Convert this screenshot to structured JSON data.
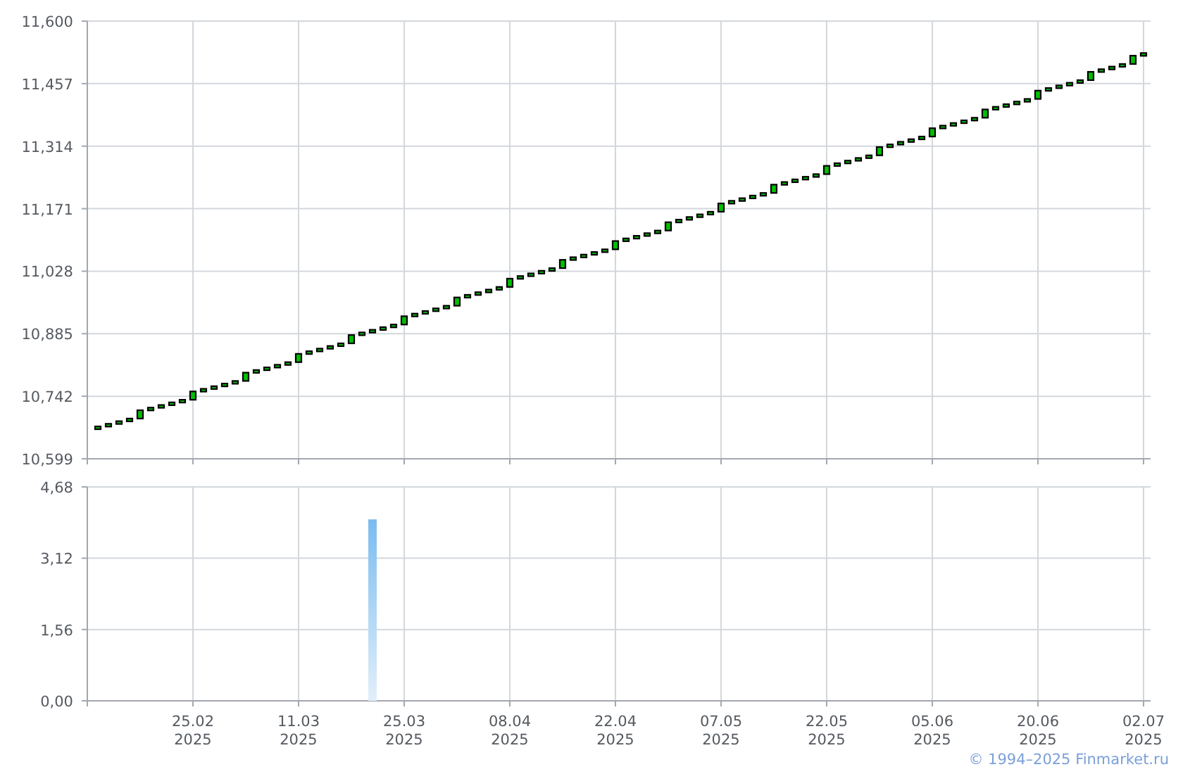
{
  "price_chart": {
    "chart_data": {
      "type": "candlestick",
      "grid": true,
      "categories": [
        null,
        null,
        null,
        null,
        null,
        null,
        null,
        null,
        null,
        null,
        null,
        null,
        null,
        null,
        null,
        null,
        null,
        null,
        null,
        null,
        null,
        null,
        null,
        null,
        null,
        null,
        null,
        null,
        null,
        null,
        null,
        null,
        null,
        null,
        null,
        null,
        null,
        null,
        null,
        null,
        null,
        null,
        null,
        null,
        null,
        null,
        null,
        null,
        null,
        null,
        null,
        null,
        null,
        null,
        null,
        null,
        null,
        null,
        null,
        null,
        null,
        null,
        null,
        null,
        null,
        null,
        null,
        null,
        null,
        null,
        null,
        null,
        null,
        null,
        null,
        null,
        null,
        null,
        null,
        null,
        null,
        null,
        null,
        null,
        null,
        null,
        null,
        null,
        null,
        null,
        null,
        null,
        null,
        null,
        null,
        null,
        null,
        null,
        null,
        null
      ],
      "ohlc": [
        [
          10667,
          10673,
          10667,
          10673
        ],
        [
          10673,
          10679,
          10673,
          10679
        ],
        [
          10679,
          10685,
          10679,
          10685
        ],
        [
          10685,
          10691,
          10685,
          10691
        ],
        [
          10691,
          10710,
          10691,
          10710
        ],
        [
          10710,
          10716,
          10710,
          10716
        ],
        [
          10716,
          10722,
          10716,
          10722
        ],
        [
          10722,
          10728,
          10722,
          10728
        ],
        [
          10728,
          10734,
          10728,
          10734
        ],
        [
          10734,
          10753,
          10734,
          10753
        ],
        [
          10753,
          10759,
          10753,
          10759
        ],
        [
          10759,
          10765,
          10759,
          10765
        ],
        [
          10765,
          10771,
          10765,
          10771
        ],
        [
          10771,
          10777,
          10771,
          10777
        ],
        [
          10777,
          10796,
          10777,
          10796
        ],
        [
          10796,
          10802,
          10796,
          10802
        ],
        [
          10802,
          10808,
          10802,
          10808
        ],
        [
          10808,
          10814,
          10808,
          10814
        ],
        [
          10814,
          10820,
          10814,
          10820
        ],
        [
          10820,
          10839,
          10820,
          10839
        ],
        [
          10839,
          10845,
          10839,
          10845
        ],
        [
          10845,
          10851,
          10845,
          10851
        ],
        [
          10851,
          10857,
          10851,
          10857
        ],
        [
          10857,
          10863,
          10857,
          10863
        ],
        [
          10863,
          10882,
          10863,
          10882
        ],
        [
          10882,
          10888,
          10882,
          10888
        ],
        [
          10888,
          10894,
          10888,
          10894
        ],
        [
          10894,
          10900,
          10894,
          10900
        ],
        [
          10900,
          10906,
          10900,
          10906
        ],
        [
          10906,
          10925,
          10906,
          10925
        ],
        [
          10925,
          10931,
          10925,
          10931
        ],
        [
          10931,
          10937,
          10931,
          10937
        ],
        [
          10937,
          10943,
          10937,
          10943
        ],
        [
          10943,
          10949,
          10943,
          10949
        ],
        [
          10949,
          10968,
          10949,
          10968
        ],
        [
          10968,
          10974,
          10968,
          10974
        ],
        [
          10974,
          10980,
          10974,
          10980
        ],
        [
          10980,
          10986,
          10980,
          10986
        ],
        [
          10986,
          10992,
          10986,
          10992
        ],
        [
          10992,
          11011,
          10992,
          11011
        ],
        [
          11011,
          11017,
          11011,
          11017
        ],
        [
          11017,
          11023,
          11017,
          11023
        ],
        [
          11023,
          11029,
          11023,
          11029
        ],
        [
          11029,
          11035,
          11029,
          11035
        ],
        [
          11035,
          11054,
          11035,
          11054
        ],
        [
          11054,
          11060,
          11054,
          11060
        ],
        [
          11060,
          11066,
          11060,
          11066
        ],
        [
          11066,
          11072,
          11066,
          11072
        ],
        [
          11072,
          11078,
          11072,
          11078
        ],
        [
          11078,
          11097,
          11078,
          11097
        ],
        [
          11097,
          11103,
          11097,
          11103
        ],
        [
          11103,
          11109,
          11103,
          11109
        ],
        [
          11109,
          11115,
          11109,
          11115
        ],
        [
          11115,
          11121,
          11115,
          11121
        ],
        [
          11121,
          11140,
          11121,
          11140
        ],
        [
          11140,
          11146,
          11140,
          11146
        ],
        [
          11146,
          11152,
          11146,
          11152
        ],
        [
          11152,
          11158,
          11152,
          11158
        ],
        [
          11158,
          11164,
          11158,
          11164
        ],
        [
          11164,
          11183,
          11164,
          11183
        ],
        [
          11183,
          11189,
          11183,
          11189
        ],
        [
          11189,
          11195,
          11189,
          11195
        ],
        [
          11195,
          11201,
          11195,
          11201
        ],
        [
          11201,
          11207,
          11201,
          11207
        ],
        [
          11207,
          11226,
          11207,
          11226
        ],
        [
          11226,
          11232,
          11226,
          11232
        ],
        [
          11232,
          11238,
          11232,
          11238
        ],
        [
          11238,
          11244,
          11238,
          11244
        ],
        [
          11244,
          11250,
          11244,
          11250
        ],
        [
          11250,
          11269,
          11250,
          11269
        ],
        [
          11269,
          11275,
          11269,
          11275
        ],
        [
          11275,
          11281,
          11275,
          11281
        ],
        [
          11281,
          11287,
          11281,
          11287
        ],
        [
          11287,
          11293,
          11287,
          11293
        ],
        [
          11293,
          11312,
          11293,
          11312
        ],
        [
          11312,
          11318,
          11312,
          11318
        ],
        [
          11318,
          11324,
          11318,
          11324
        ],
        [
          11324,
          11330,
          11324,
          11330
        ],
        [
          11330,
          11336,
          11330,
          11336
        ],
        [
          11336,
          11355,
          11336,
          11355
        ],
        [
          11355,
          11361,
          11355,
          11361
        ],
        [
          11361,
          11367,
          11361,
          11367
        ],
        [
          11367,
          11373,
          11367,
          11373
        ],
        [
          11373,
          11379,
          11373,
          11379
        ],
        [
          11379,
          11398,
          11379,
          11398
        ],
        [
          11398,
          11404,
          11398,
          11404
        ],
        [
          11404,
          11410,
          11404,
          11410
        ],
        [
          11410,
          11416,
          11410,
          11416
        ],
        [
          11416,
          11422,
          11416,
          11422
        ],
        [
          11422,
          11441,
          11422,
          11441
        ],
        [
          11441,
          11447,
          11441,
          11447
        ],
        [
          11447,
          11453,
          11447,
          11453
        ],
        [
          11453,
          11459,
          11453,
          11459
        ],
        [
          11459,
          11465,
          11459,
          11465
        ],
        [
          11465,
          11484,
          11465,
          11484
        ],
        [
          11484,
          11490,
          11484,
          11490
        ],
        [
          11490,
          11496,
          11490,
          11496
        ],
        [
          11496,
          11502,
          11496,
          11502
        ],
        [
          11502,
          11521,
          11502,
          11521
        ],
        [
          11521,
          11527,
          11521,
          11527
        ]
      ],
      "ylim": [
        10599,
        11600
      ],
      "yticks": [
        {
          "value": 10599,
          "label": "10,599"
        },
        {
          "value": 10742,
          "label": "10,742"
        },
        {
          "value": 10885,
          "label": "10,885"
        },
        {
          "value": 11028,
          "label": "11,028"
        },
        {
          "value": 11171,
          "label": "11,171"
        },
        {
          "value": 11314,
          "label": "11,314"
        },
        {
          "value": 11457,
          "label": "11,457"
        },
        {
          "value": 11600,
          "label": "11,600"
        }
      ]
    }
  },
  "volume_chart": {
    "chart_data": {
      "type": "bar",
      "grid": true,
      "categories": [
        null,
        null,
        null,
        null,
        null,
        null,
        null,
        null,
        null,
        "25.02\n2025",
        null,
        null,
        null,
        null,
        null,
        null,
        null,
        null,
        null,
        "11.03\n2025",
        null,
        null,
        null,
        null,
        null,
        null,
        null,
        null,
        null,
        "25.03\n2025",
        null,
        null,
        null,
        null,
        null,
        null,
        null,
        null,
        null,
        "08.04\n2025",
        null,
        null,
        null,
        null,
        null,
        null,
        null,
        null,
        null,
        "22.04\n2025",
        null,
        null,
        null,
        null,
        null,
        null,
        null,
        null,
        null,
        "07.05\n2025",
        null,
        null,
        null,
        null,
        null,
        null,
        null,
        null,
        null,
        "22.05\n2025",
        null,
        null,
        null,
        null,
        null,
        null,
        null,
        null,
        null,
        "05.06\n2025",
        null,
        null,
        null,
        null,
        null,
        null,
        null,
        null,
        null,
        "20.06\n2025",
        null,
        null,
        null,
        null,
        null,
        null,
        null,
        null,
        null,
        "02.07\n2025"
      ],
      "values": [
        null,
        null,
        null,
        null,
        null,
        null,
        null,
        null,
        null,
        null,
        null,
        null,
        null,
        null,
        null,
        null,
        null,
        null,
        null,
        null,
        null,
        null,
        null,
        null,
        null,
        null,
        3.97,
        null,
        null,
        null,
        null,
        null,
        null,
        null,
        null,
        null,
        null,
        null,
        null,
        null,
        null,
        null,
        null,
        null,
        null,
        null,
        null,
        null,
        null,
        null,
        null,
        null,
        null,
        null,
        null,
        null,
        null,
        null,
        null,
        null,
        null,
        null,
        null,
        null,
        null,
        null,
        null,
        null,
        null,
        null,
        null,
        null,
        null,
        null,
        null,
        null,
        null,
        null,
        null,
        null,
        null,
        null,
        null,
        null,
        null,
        null,
        null,
        null,
        null,
        null,
        null,
        null,
        null,
        null,
        null,
        null,
        null,
        null,
        null,
        null
      ],
      "ylim": [
        0,
        4.68
      ],
      "yticks": [
        {
          "value": 0,
          "label": "0,00"
        },
        {
          "value": 1.56,
          "label": "1,56"
        },
        {
          "value": 3.12,
          "label": "3,12"
        },
        {
          "value": 4.68,
          "label": "4,68"
        }
      ]
    }
  },
  "footer": {
    "copyright": "© 1994–2025 Finmarket.ru"
  }
}
